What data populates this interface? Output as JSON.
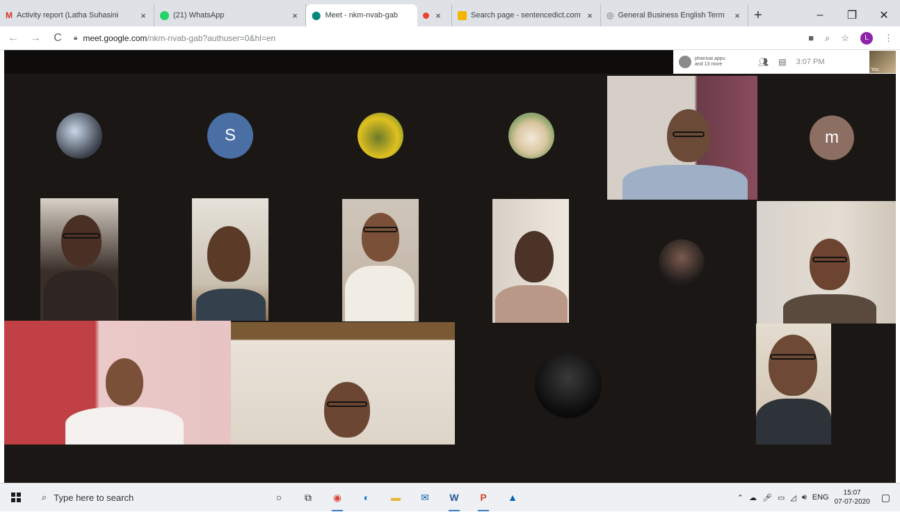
{
  "browser": {
    "tabs": [
      {
        "label": "Activity report (Latha Suhasini",
        "icon": "gmail-icon",
        "color": "#d93025",
        "active": false
      },
      {
        "label": "(21) WhatsApp",
        "icon": "whatsapp-icon",
        "color": "#25d366",
        "active": false
      },
      {
        "label": "Meet - nkm-nvab-gab",
        "icon": "meet-icon",
        "color": "#00897b",
        "active": true
      },
      {
        "label": "",
        "icon": "recording-icon",
        "color": "#ea4335",
        "active": false
      },
      {
        "label": "Search page - sentencedict.com",
        "icon": "sentencedict-icon",
        "color": "#f4b400",
        "active": false
      },
      {
        "label": "General Business English Term",
        "icon": "globe-icon",
        "color": "#5f6368",
        "active": false
      }
    ],
    "url_host": "meet.google.com",
    "url_rest": "/nkm-nvab-gab?authuser=0&hl=en",
    "profile_initial": "L"
  },
  "meet": {
    "participants_line1": "phanisai appu",
    "participants_line2": "and 13 more",
    "time": "3:07 PM",
    "self_label": "You",
    "avatars": [
      {
        "letter": "S",
        "color": "#4a6fa5"
      },
      {
        "letter": "m",
        "color": "#8d6e63"
      }
    ]
  },
  "taskbar": {
    "search_placeholder": "Type here to search",
    "language": "ENG",
    "time": "15:07",
    "date": "07-07-2020"
  }
}
